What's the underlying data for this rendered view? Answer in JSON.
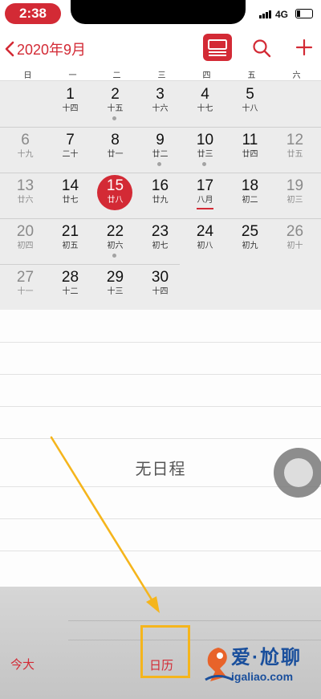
{
  "status_bar": {
    "time": "2:38",
    "network": "4G"
  },
  "nav": {
    "back_label": "2020年9月"
  },
  "weekdays": [
    "日",
    "一",
    "二",
    "三",
    "四",
    "五",
    "六"
  ],
  "month": {
    "weeks": [
      [
        null,
        {
          "day": "1",
          "lunar": "十四"
        },
        {
          "day": "2",
          "lunar": "十五",
          "dot": true
        },
        {
          "day": "3",
          "lunar": "十六"
        },
        {
          "day": "4",
          "lunar": "十七"
        },
        {
          "day": "5",
          "lunar": "十八"
        }
      ],
      [
        {
          "day": "6",
          "lunar": "十九"
        },
        {
          "day": "7",
          "lunar": "二十"
        },
        {
          "day": "8",
          "lunar": "廿一"
        },
        {
          "day": "9",
          "lunar": "廿二",
          "dot": true
        },
        {
          "day": "10",
          "lunar": "廿三",
          "dot": true
        },
        {
          "day": "11",
          "lunar": "廿四"
        },
        {
          "day": "12",
          "lunar": "廿五"
        }
      ],
      [
        {
          "day": "13",
          "lunar": "廿六"
        },
        {
          "day": "14",
          "lunar": "廿七"
        },
        {
          "day": "15",
          "lunar": "廿八",
          "today": true
        },
        {
          "day": "16",
          "lunar": "廿九"
        },
        {
          "day": "17",
          "lunar": "八月",
          "underline": true
        },
        {
          "day": "18",
          "lunar": "初二"
        },
        {
          "day": "19",
          "lunar": "初三"
        }
      ],
      [
        {
          "day": "20",
          "lunar": "初四"
        },
        {
          "day": "21",
          "lunar": "初五"
        },
        {
          "day": "22",
          "lunar": "初六",
          "dot": true
        },
        {
          "day": "23",
          "lunar": "初七"
        },
        {
          "day": "24",
          "lunar": "初八"
        },
        {
          "day": "25",
          "lunar": "初九"
        },
        {
          "day": "26",
          "lunar": "初十"
        }
      ],
      [
        {
          "day": "27",
          "lunar": "十一"
        },
        {
          "day": "28",
          "lunar": "十二"
        },
        {
          "day": "29",
          "lunar": "十三"
        },
        {
          "day": "30",
          "lunar": "十四"
        }
      ]
    ]
  },
  "events": {
    "empty_label": "无日程"
  },
  "tabbar": {
    "today_label": "今大",
    "calendars_label": "日历"
  },
  "watermark": {
    "title": "爱·尬聊",
    "url": "igaliao.com"
  },
  "colors": {
    "accent": "#d32a35",
    "annotation": "#f5b51c"
  }
}
